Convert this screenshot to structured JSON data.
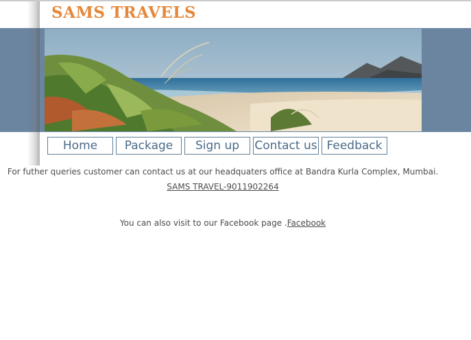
{
  "header": {
    "logo_text": "SAMS TRAVELS"
  },
  "banner": {
    "image_name": "beach-banner-image"
  },
  "nav": {
    "items": [
      {
        "label": "Home"
      },
      {
        "label": "Package"
      },
      {
        "label": "Sign up"
      },
      {
        "label": "Contact us"
      },
      {
        "label": "Feedback"
      }
    ]
  },
  "content": {
    "contact_text": "For futher queries customer can contact us at our headquaters office at Bandra Kurla Complex, Mumbai.",
    "phone_link": "SAMS TRAVEL-9011902264",
    "facebook_prefix": "You can also visit to our Facebook page .",
    "facebook_link": "Facebook"
  },
  "colors": {
    "logo": "#e6883b",
    "band": "#6b849f",
    "nav_text": "#4a6a88",
    "nav_border": "#5f7f99",
    "body_text": "#4b4b4b"
  }
}
